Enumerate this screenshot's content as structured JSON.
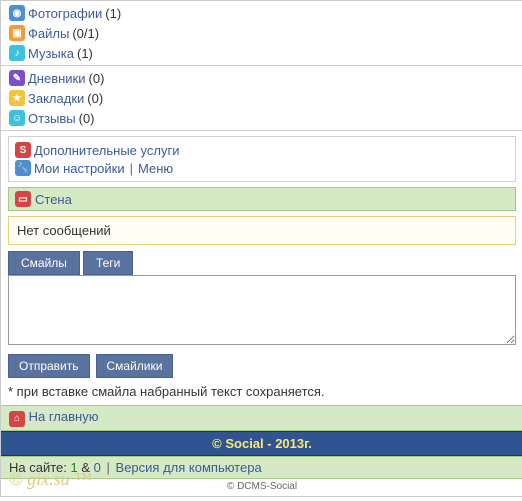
{
  "nav1": [
    {
      "icon": "i-blue",
      "glyph": "◉",
      "label": "Фотографии",
      "count": "(1)"
    },
    {
      "icon": "i-orange",
      "glyph": "▣",
      "label": "Файлы",
      "count": "(0/1)"
    },
    {
      "icon": "i-cyan",
      "glyph": "♪",
      "label": "Музыка",
      "count": "(1)"
    }
  ],
  "nav2": [
    {
      "icon": "i-purple",
      "glyph": "✎",
      "label": "Дневники",
      "count": "(0)"
    },
    {
      "icon": "i-yellow",
      "glyph": "★",
      "label": "Закладки",
      "count": "(0)"
    },
    {
      "icon": "i-cyan",
      "glyph": "☺",
      "label": "Отзывы",
      "count": "(0)"
    }
  ],
  "settings": {
    "extra": {
      "icon": "i-red",
      "glyph": "S",
      "label": "Дополнительные услуги"
    },
    "my": {
      "icon": "i-blue",
      "glyph": "🔧",
      "label": "Мои настройки"
    },
    "menu": "Меню",
    "sep": "|"
  },
  "wall": {
    "icon": "i-red",
    "glyph": "▭",
    "title": "Стена",
    "empty": "Нет сообщений",
    "tabs": {
      "smiles": "Смайлы",
      "tags": "Теги"
    },
    "textarea": "",
    "buttons": {
      "send": "Отправить",
      "smilies": "Смайлики"
    },
    "hint": "* при вставке смайла набранный текст сохраняется."
  },
  "home": {
    "icon": "i-red",
    "glyph": "⌂",
    "label": "На главную"
  },
  "copyright": "© Social - 2013г.",
  "online": {
    "prefix": "На сайте:",
    "n1": "1",
    "amp": "&",
    "n0": "0",
    "sep": "|",
    "pc": "Версия для компьютера"
  },
  "footer": "© DCMS-Social",
  "watermark": "© gix.su ™"
}
